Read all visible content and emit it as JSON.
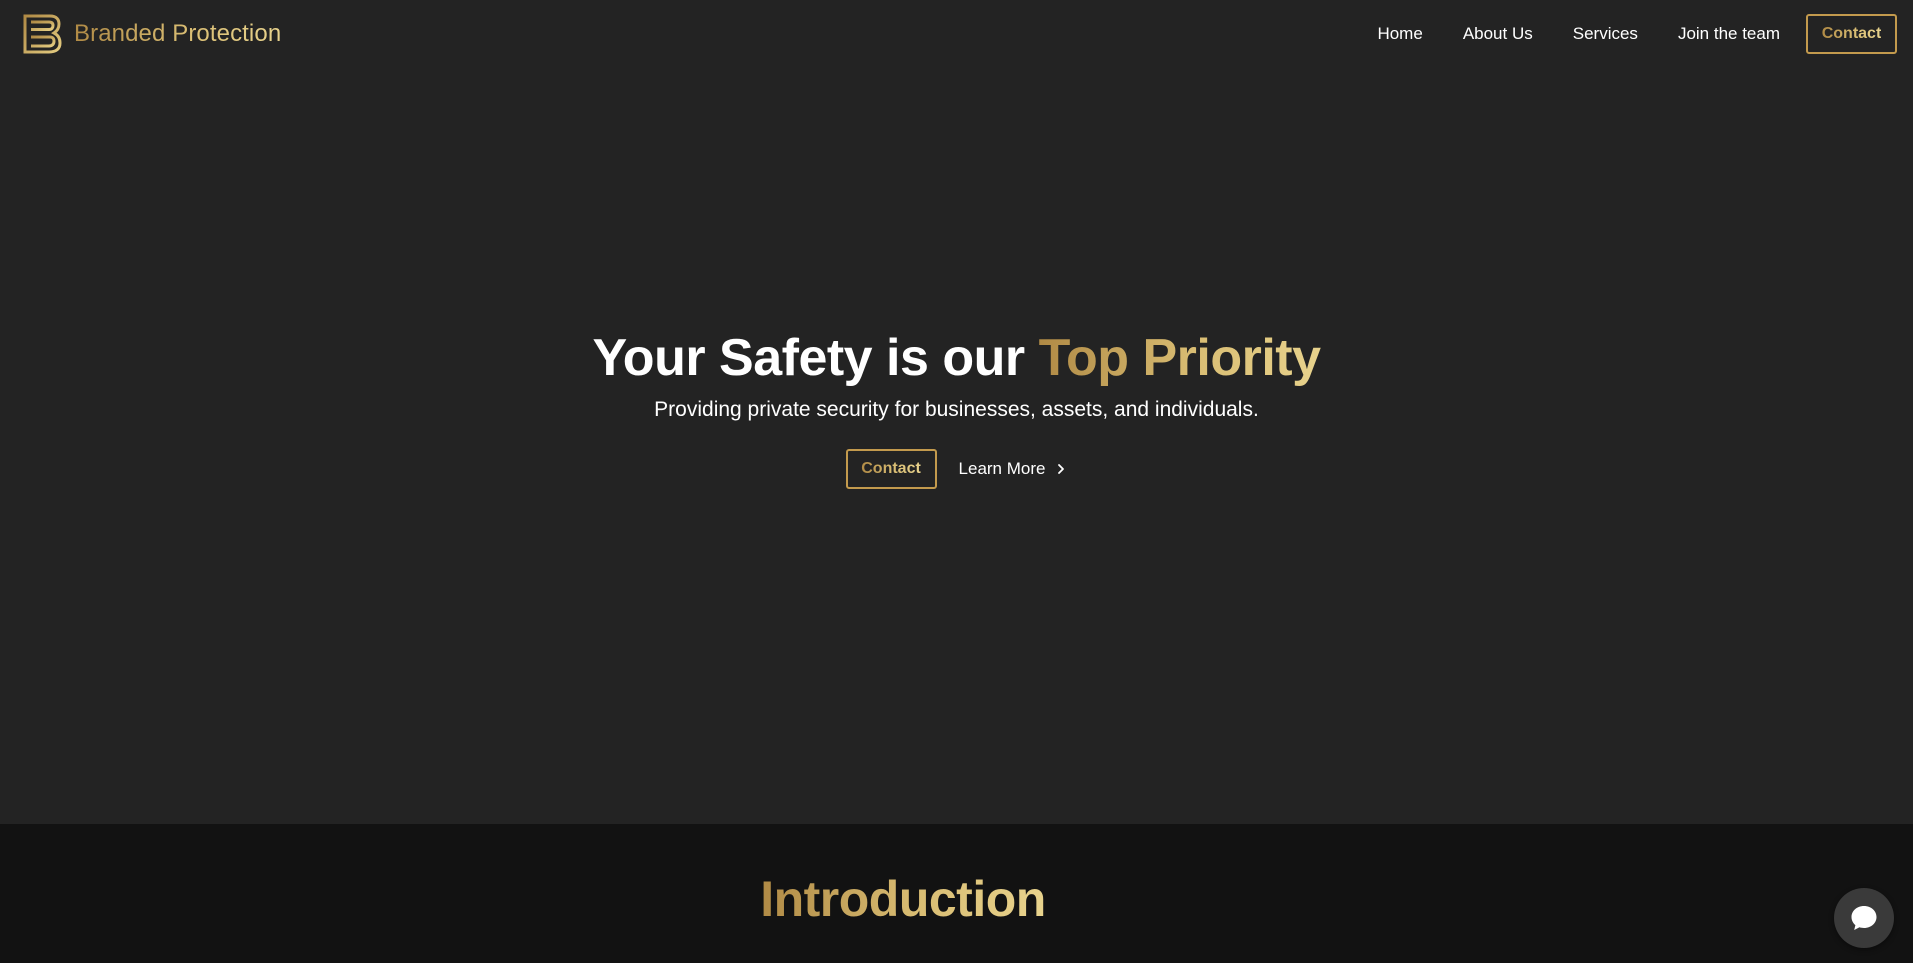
{
  "brand": {
    "name": "Branded Protection",
    "logo_icon": "brand-b-logo-icon"
  },
  "nav": {
    "links": [
      {
        "label": "Home"
      },
      {
        "label": "About Us"
      },
      {
        "label": "Services"
      },
      {
        "label": "Join the team"
      }
    ],
    "contact_label": "Contact"
  },
  "hero": {
    "title_part1": "Your Safety is our ",
    "title_highlight": "Top Priority",
    "subtitle": "Providing private security for businesses, assets, and individuals.",
    "contact_label": "Contact",
    "learn_more_label": "Learn More",
    "learn_more_icon": "chevron-right-icon"
  },
  "intro": {
    "title": "Introduction"
  },
  "chat": {
    "icon": "chat-bubble-icon"
  },
  "colors": {
    "background": "#232323",
    "section_dark": "#121212",
    "gold": "#c39a4d",
    "gold_light": "#e8d38d",
    "text": "#ffffff"
  }
}
